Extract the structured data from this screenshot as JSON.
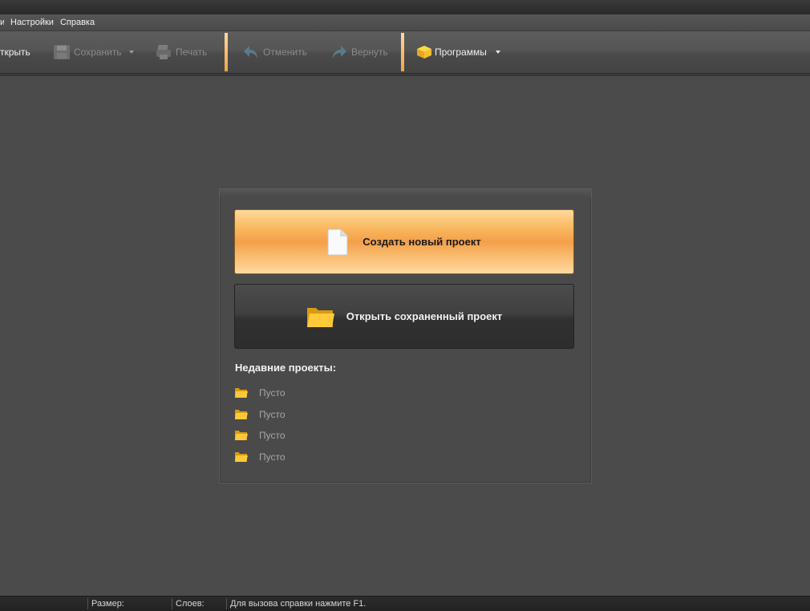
{
  "menu": {
    "items": [
      "Настройки",
      "Справка"
    ]
  },
  "toolbar": {
    "open_label": "ткрыть",
    "save_label": "Сохранить",
    "print_label": "Печать",
    "undo_label": "Отменить",
    "redo_label": "Вернуть",
    "programs_label": "Программы"
  },
  "panel": {
    "new_project_label": "Создать новый проект",
    "open_project_label": "Открыть сохраненный проект",
    "recent_title": "Недавние проекты:",
    "recent_items": [
      "Пусто",
      "Пусто",
      "Пусто",
      "Пусто"
    ]
  },
  "status": {
    "size_label": "Размер:",
    "layers_label": "Слоев:",
    "help_text": "Для вызова справки нажмите F1."
  },
  "colors": {
    "accent": "#f3a04a",
    "background": "#4b4b4b"
  }
}
